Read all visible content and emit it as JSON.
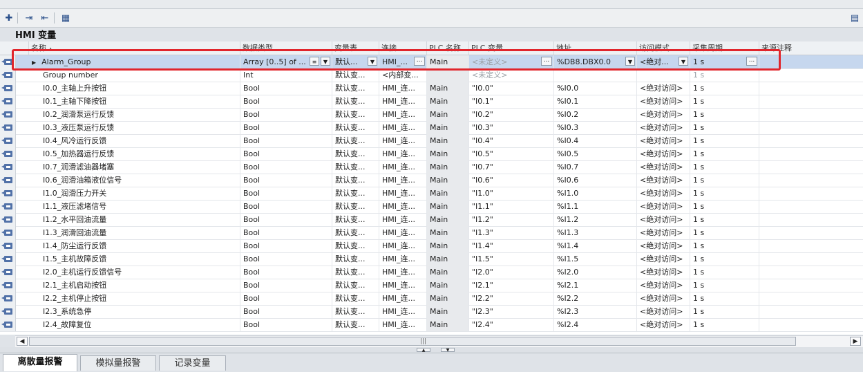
{
  "panel": {
    "title": "HMI 变量"
  },
  "columns": {
    "name": "名称",
    "datatype": "数据类型",
    "table": "变量表",
    "connection": "连接",
    "plc_name": "PLC 名称",
    "plc_tag": "PLC 变量",
    "address": "地址",
    "access": "访问模式",
    "cycle": "采集周期",
    "comment": "来源注释",
    "sort_indicator": "▲"
  },
  "rows": [
    {
      "name": "Alarm_Group",
      "datatype": "Array [0..5] of ...",
      "table": "默认...",
      "connection": "HMI_...",
      "plc_name": "Main",
      "plc_tag": "<未定义>",
      "address": "%DB8.DBX0.0",
      "access": "<绝对...",
      "cycle": "1 s"
    },
    {
      "name": "Group number",
      "datatype": "Int",
      "table": "默认变...",
      "connection": "<内部变...",
      "plc_name": "",
      "plc_tag": "<未定义>",
      "address": "",
      "access": "",
      "cycle": "1 s"
    },
    {
      "name": "I0.0_主轴上升按钮",
      "datatype": "Bool",
      "table": "默认变...",
      "connection": "HMI_连...",
      "plc_name": "Main",
      "plc_tag": "\"I0.0\"",
      "address": "%I0.0",
      "access": "<绝对访问>",
      "cycle": "1 s"
    },
    {
      "name": "I0.1_主轴下降按钮",
      "datatype": "Bool",
      "table": "默认变...",
      "connection": "HMI_连...",
      "plc_name": "Main",
      "plc_tag": "\"I0.1\"",
      "address": "%I0.1",
      "access": "<绝对访问>",
      "cycle": "1 s"
    },
    {
      "name": "I0.2_润滑泵运行反馈",
      "datatype": "Bool",
      "table": "默认变...",
      "connection": "HMI_连...",
      "plc_name": "Main",
      "plc_tag": "\"I0.2\"",
      "address": "%I0.2",
      "access": "<绝对访问>",
      "cycle": "1 s"
    },
    {
      "name": "I0.3_液压泵运行反馈",
      "datatype": "Bool",
      "table": "默认变...",
      "connection": "HMI_连...",
      "plc_name": "Main",
      "plc_tag": "\"I0.3\"",
      "address": "%I0.3",
      "access": "<绝对访问>",
      "cycle": "1 s"
    },
    {
      "name": "I0.4_风冷运行反馈",
      "datatype": "Bool",
      "table": "默认变...",
      "connection": "HMI_连...",
      "plc_name": "Main",
      "plc_tag": "\"I0.4\"",
      "address": "%I0.4",
      "access": "<绝对访问>",
      "cycle": "1 s"
    },
    {
      "name": "I0.5_加热器运行反馈",
      "datatype": "Bool",
      "table": "默认变...",
      "connection": "HMI_连...",
      "plc_name": "Main",
      "plc_tag": "\"I0.5\"",
      "address": "%I0.5",
      "access": "<绝对访问>",
      "cycle": "1 s"
    },
    {
      "name": "I0.7_润滑滤油器堵塞",
      "datatype": "Bool",
      "table": "默认变...",
      "connection": "HMI_连...",
      "plc_name": "Main",
      "plc_tag": "\"I0.7\"",
      "address": "%I0.7",
      "access": "<绝对访问>",
      "cycle": "1 s"
    },
    {
      "name": "I0.6_润滑油箱液位信号",
      "datatype": "Bool",
      "table": "默认变...",
      "connection": "HMI_连...",
      "plc_name": "Main",
      "plc_tag": "\"I0.6\"",
      "address": "%I0.6",
      "access": "<绝对访问>",
      "cycle": "1 s"
    },
    {
      "name": "I1.0_润滑压力开关",
      "datatype": "Bool",
      "table": "默认变...",
      "connection": "HMI_连...",
      "plc_name": "Main",
      "plc_tag": "\"I1.0\"",
      "address": "%I1.0",
      "access": "<绝对访问>",
      "cycle": "1 s"
    },
    {
      "name": "I1.1_液压滤堵信号",
      "datatype": "Bool",
      "table": "默认变...",
      "connection": "HMI_连...",
      "plc_name": "Main",
      "plc_tag": "\"I1.1\"",
      "address": "%I1.1",
      "access": "<绝对访问>",
      "cycle": "1 s"
    },
    {
      "name": "I1.2_水平回油流量",
      "datatype": "Bool",
      "table": "默认变...",
      "connection": "HMI_连...",
      "plc_name": "Main",
      "plc_tag": "\"I1.2\"",
      "address": "%I1.2",
      "access": "<绝对访问>",
      "cycle": "1 s"
    },
    {
      "name": "I1.3_润滑回油流量",
      "datatype": "Bool",
      "table": "默认变...",
      "connection": "HMI_连...",
      "plc_name": "Main",
      "plc_tag": "\"I1.3\"",
      "address": "%I1.3",
      "access": "<绝对访问>",
      "cycle": "1 s"
    },
    {
      "name": "I1.4_防尘运行反馈",
      "datatype": "Bool",
      "table": "默认变...",
      "connection": "HMI_连...",
      "plc_name": "Main",
      "plc_tag": "\"I1.4\"",
      "address": "%I1.4",
      "access": "<绝对访问>",
      "cycle": "1 s"
    },
    {
      "name": "I1.5_主机故障反馈",
      "datatype": "Bool",
      "table": "默认变...",
      "connection": "HMI_连...",
      "plc_name": "Main",
      "plc_tag": "\"I1.5\"",
      "address": "%I1.5",
      "access": "<绝对访问>",
      "cycle": "1 s"
    },
    {
      "name": "I2.0_主机运行反馈信号",
      "datatype": "Bool",
      "table": "默认变...",
      "connection": "HMI_连...",
      "plc_name": "Main",
      "plc_tag": "\"I2.0\"",
      "address": "%I2.0",
      "access": "<绝对访问>",
      "cycle": "1 s"
    },
    {
      "name": "I2.1_主机启动按钮",
      "datatype": "Bool",
      "table": "默认变...",
      "connection": "HMI_连...",
      "plc_name": "Main",
      "plc_tag": "\"I2.1\"",
      "address": "%I2.1",
      "access": "<绝对访问>",
      "cycle": "1 s"
    },
    {
      "name": "I2.2_主机停止按钮",
      "datatype": "Bool",
      "table": "默认变...",
      "connection": "HMI_连...",
      "plc_name": "Main",
      "plc_tag": "\"I2.2\"",
      "address": "%I2.2",
      "access": "<绝对访问>",
      "cycle": "1 s"
    },
    {
      "name": "I2.3_系统急停",
      "datatype": "Bool",
      "table": "默认变...",
      "connection": "HMI_连...",
      "plc_name": "Main",
      "plc_tag": "\"I2.3\"",
      "address": "%I2.3",
      "access": "<绝对访问>",
      "cycle": "1 s"
    },
    {
      "name": "I2.4_故障复位",
      "datatype": "Bool",
      "table": "默认变...",
      "connection": "HMI_连...",
      "plc_name": "Main",
      "plc_tag": "\"I2.4\"",
      "address": "%I2.4",
      "access": "<绝对访问>",
      "cycle": "1 s"
    }
  ],
  "tabs": [
    {
      "label": "离散量报警",
      "active": true
    },
    {
      "label": "模拟量报警",
      "active": false
    },
    {
      "label": "记录变量",
      "active": false
    }
  ],
  "icons": {
    "add": "add-tag-icon",
    "export": "export-icon",
    "import": "import-icon",
    "settings": "table-settings-icon",
    "tag": "hmi-tag-icon",
    "expand": "expand-arrow-icon"
  },
  "colors": {
    "selected_row": "#c6d7ee",
    "highlight_box": "#e1262c",
    "tag_icon": "#5272a8"
  }
}
